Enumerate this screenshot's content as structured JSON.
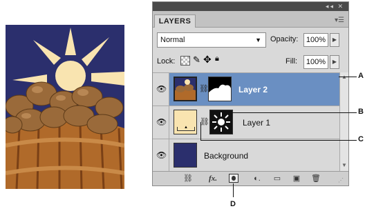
{
  "panel": {
    "tab_label": "LAYERS",
    "blend_mode": "Normal",
    "opacity_label": "Opacity:",
    "opacity_value": "100%",
    "lock_label": "Lock:",
    "fill_label": "Fill:",
    "fill_value": "100%",
    "layers": [
      {
        "name": "Layer 2",
        "selected": true
      },
      {
        "name": "Layer 1",
        "selected": false
      },
      {
        "name": "Background",
        "selected": false
      }
    ]
  },
  "callouts": [
    "A",
    "B",
    "C",
    "D"
  ],
  "colors": {
    "selected_row": "#6a8fc2",
    "panel_bg": "#d9d9d9",
    "navy": "#2b2f6d",
    "cream": "#f9e4b0"
  }
}
